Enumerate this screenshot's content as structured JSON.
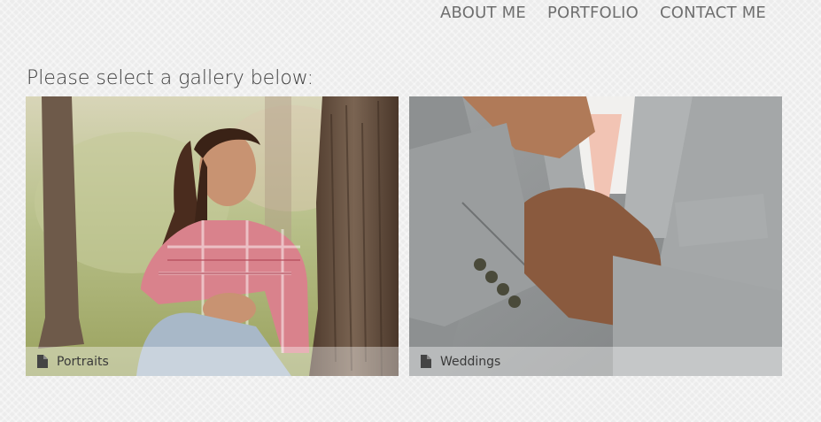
{
  "nav": {
    "items": [
      "ABOUT ME",
      "PORTFOLIO",
      "CONTACT ME"
    ]
  },
  "page": {
    "heading": "Please select a gallery below:"
  },
  "galleries": [
    {
      "label": "Portraits",
      "icon": "file-icon"
    },
    {
      "label": "Weddings",
      "icon": "file-icon"
    }
  ]
}
